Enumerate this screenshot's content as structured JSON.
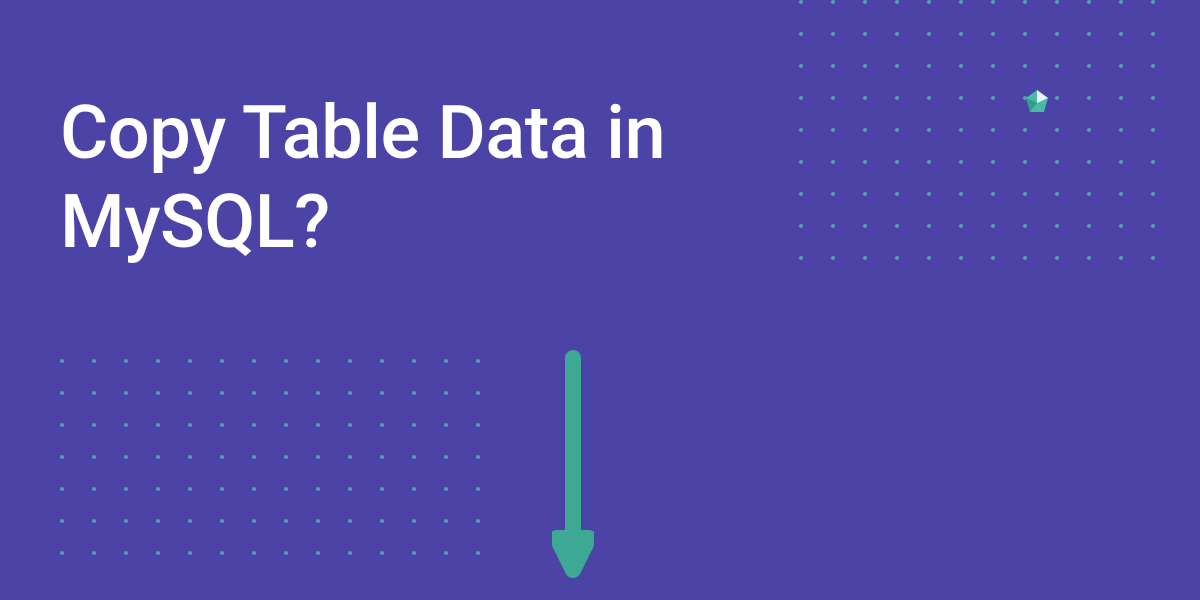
{
  "title": "Copy Table Data in MySQL?",
  "colors": {
    "background": "#4C43A7",
    "text": "#ffffff",
    "accent": "#4CC0A8",
    "arrow": "#3DA893"
  },
  "decorations": {
    "dot_grid_top_right": {
      "cols": 12,
      "rows": 9
    },
    "dot_grid_bottom_left": {
      "cols": 14,
      "rows": 7
    },
    "arrow_direction": "down",
    "logo_name": "diamond-logo"
  }
}
